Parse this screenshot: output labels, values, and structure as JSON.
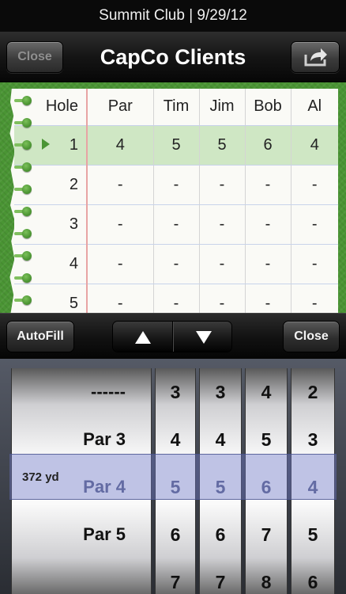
{
  "status_bar": {
    "text": "Summit Club | 9/29/12"
  },
  "nav": {
    "title": "CapCo Clients",
    "close_label": "Close",
    "share_icon": "share-icon"
  },
  "scorecard": {
    "headers": {
      "hole": "Hole",
      "par": "Par",
      "players": [
        "Tim",
        "Jim",
        "Bob",
        "Al"
      ]
    },
    "rows": [
      {
        "hole": "1",
        "par": "4",
        "scores": [
          "5",
          "5",
          "6",
          "4"
        ],
        "selected": true
      },
      {
        "hole": "2",
        "par": "-",
        "scores": [
          "-",
          "-",
          "-",
          "-"
        ]
      },
      {
        "hole": "3",
        "par": "-",
        "scores": [
          "-",
          "-",
          "-",
          "-"
        ]
      },
      {
        "hole": "4",
        "par": "-",
        "scores": [
          "-",
          "-",
          "-",
          "-"
        ]
      },
      {
        "hole": "5",
        "par": "-",
        "scores": [
          "-",
          "-",
          "-",
          "-"
        ]
      }
    ]
  },
  "toolbar": {
    "autofill_label": "AutoFill",
    "close_label": "Close"
  },
  "picker": {
    "yardage": "372 yd",
    "par_wheel": [
      "------",
      "Par 3",
      "Par 4",
      "Par 5"
    ],
    "player_wheels": [
      [
        "3",
        "4",
        "5",
        "6",
        "7"
      ],
      [
        "3",
        "4",
        "5",
        "6",
        "7"
      ],
      [
        "4",
        "5",
        "6",
        "7",
        "8"
      ],
      [
        "2",
        "3",
        "4",
        "5",
        "6"
      ]
    ]
  },
  "colors": {
    "board_green": "#4a9534",
    "selected_row": "#cfe7c4",
    "picker_band": "#6e78c8"
  }
}
